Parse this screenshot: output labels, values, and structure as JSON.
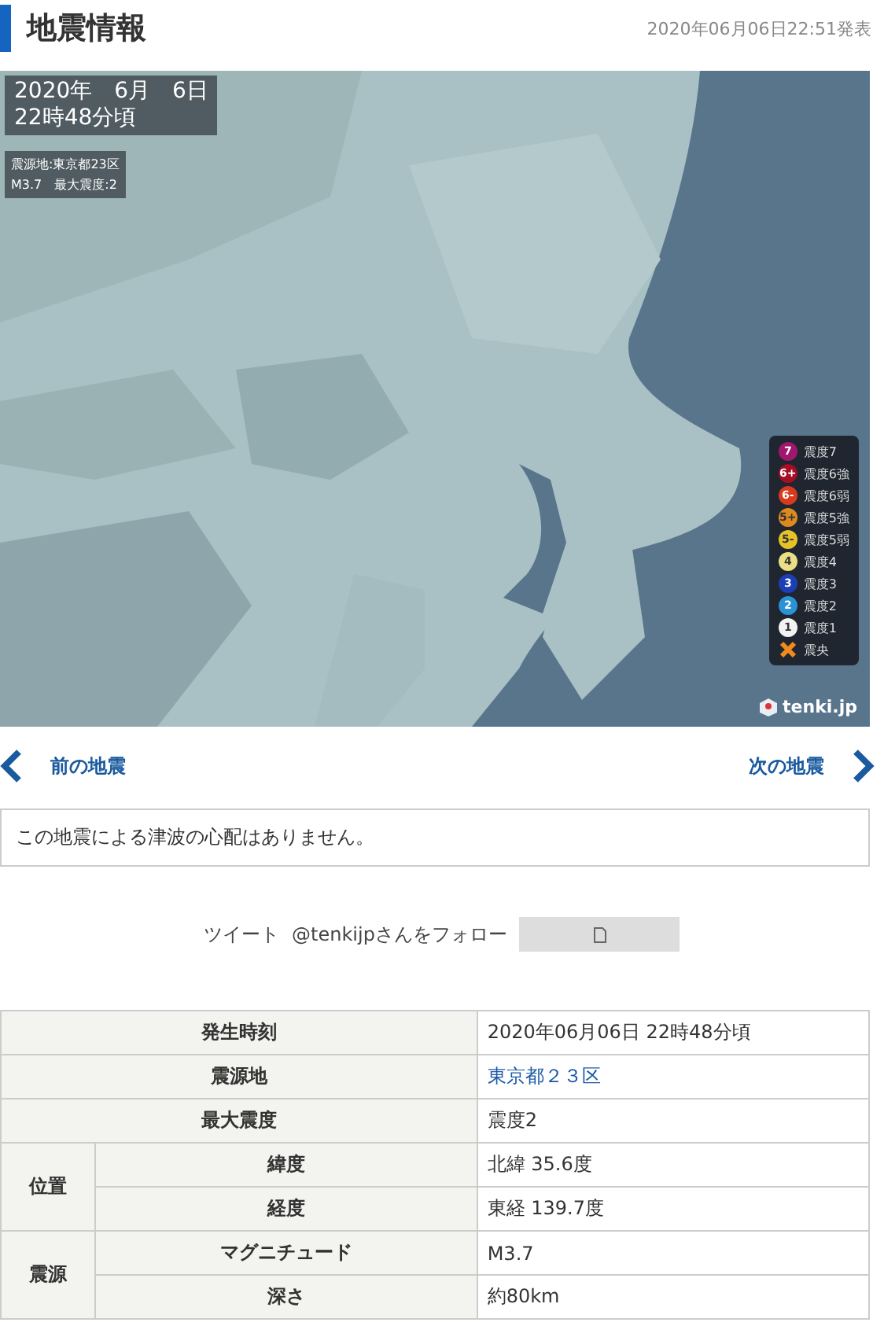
{
  "header": {
    "title": "地震情報",
    "published": "2020年06月06日22:51発表"
  },
  "map": {
    "kind": "picture",
    "date_line": "2020年　6月　6日",
    "time_line": "22時48分頃",
    "epicenter_line": "震源地:東京都23区",
    "summary_line": "M3.7　最大震度:2",
    "legend": [
      {
        "badge": "7",
        "label": "震度7",
        "color": "#a0186e",
        "kind": "dot"
      },
      {
        "badge": "6+",
        "label": "震度6強",
        "color": "#a50d24",
        "kind": "dot"
      },
      {
        "badge": "6-",
        "label": "震度6弱",
        "color": "#d83a1e",
        "kind": "dot"
      },
      {
        "badge": "5+",
        "label": "震度5強",
        "color": "#dc8a1e",
        "kind": "dot"
      },
      {
        "badge": "5-",
        "label": "震度5弱",
        "color": "#e6c229",
        "kind": "dot"
      },
      {
        "badge": "4",
        "label": "震度4",
        "color": "#eadf86",
        "kind": "dot"
      },
      {
        "badge": "3",
        "label": "震度3",
        "color": "#1c3fb5",
        "kind": "dot"
      },
      {
        "badge": "2",
        "label": "震度2",
        "color": "#2a93d6",
        "kind": "dot"
      },
      {
        "badge": "1",
        "label": "震度1",
        "color": "#f2f2f2",
        "kind": "dot"
      },
      {
        "label": "震央",
        "color": "#f08a1c",
        "kind": "cross"
      }
    ],
    "brand": "tenki.jp"
  },
  "nav": {
    "prev": "前の地震",
    "next": "次の地震"
  },
  "notice": "この地震による津波の心配はありません。",
  "social": {
    "tweet": "ツイート",
    "follow": "@tenkijpさんをフォロー"
  },
  "table": [
    {
      "label": "発生時刻",
      "value": "2020年06月06日 22時48分頃",
      "link": false
    },
    {
      "label": "震源地",
      "value": "東京都２３区",
      "link": true
    },
    {
      "label": "最大震度",
      "value": "震度2",
      "link": false
    },
    {
      "group": "位置",
      "rows": [
        {
          "label": "緯度",
          "value": "北緯 35.6度",
          "link": false
        },
        {
          "label": "経度",
          "value": "東経 139.7度",
          "link": false
        }
      ]
    },
    {
      "group": "震源",
      "rows": [
        {
          "label": "マグニチュード",
          "value": "M3.7",
          "link": false
        },
        {
          "label": "深さ",
          "value": "約80km",
          "link": false
        }
      ]
    }
  ]
}
